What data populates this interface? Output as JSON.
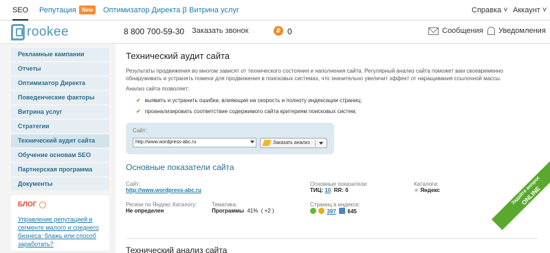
{
  "topnav": {
    "tabs": [
      {
        "label": "SEO"
      },
      {
        "label": "Репутация",
        "badge": "New"
      },
      {
        "label": "Оптимизатор Директа β"
      },
      {
        "label": "Витрина услуг"
      }
    ],
    "help": "Справка",
    "account": "Аккаунт"
  },
  "header": {
    "logo": "rookee",
    "phone": "8 800 700-59-30",
    "callback": "Заказать звонок",
    "coin": "₽",
    "balance": "0",
    "messages": "Сообщения",
    "notifications": "Уведомления"
  },
  "sidebar": {
    "items": [
      {
        "label": "Рекламные кампании"
      },
      {
        "label": "Отчеты"
      },
      {
        "label": "Оптимизатор Директа"
      },
      {
        "label": "Поведенческие факторы"
      },
      {
        "label": "Витрина услуг"
      },
      {
        "label": "Стратегии"
      },
      {
        "label": "Технический аудит сайта"
      },
      {
        "label": "Обучение основам SEO"
      },
      {
        "label": "Партнерская программа"
      },
      {
        "label": "Документы"
      }
    ],
    "blog_title": "БЛОГ",
    "blog_link": "Управление репутацией в сегменте малого и среднего бизнеса: блажь или способ заработать?"
  },
  "main": {
    "title": "Технический аудит сайта",
    "intro": "Результаты продвижения во многом зависят от технического состояния и наполнения сайта. Регулярный анализ сайта поможет вам своевременно обнаруживать и устранять помехи для продвижения в поисковых системах, что значительно увеличит эффект от наращивания ссылочной массы.",
    "allows": "Анализ сайта позволяет:",
    "bullets": [
      "выявить и устранить ошибки, влияющие на скорость и полноту индексации страниц;",
      "проанализировать соответствие содержимого сайта критериям поисковых систем;"
    ],
    "site_label": "Сайт:",
    "site_value": "http://www.wordpress-abc.ru",
    "order_button": "Заказать анализ",
    "section_title": "Основные показатели сайта",
    "site_field_label": "Сайт:",
    "site_link": "http://www.wordpress-abc.ru",
    "indicators_label": "Основные показатели:",
    "tic_label": "ТИЦ:",
    "tic_value": "10",
    "rr_label": "RR:",
    "rr_value": "0",
    "catalogs_label": "Каталоги:",
    "catalogs_value": "Яндекс",
    "region_label": "Регион по Яндекс Каталогу:",
    "region_value": "Не определен",
    "theme_label": "Тематика:",
    "theme_value": "Программы",
    "theme_percent": "41%",
    "theme_delta": "( +2 )",
    "pages_label": "Страниц в индексе:",
    "pages_yandex": "397",
    "pages_google": "645",
    "tech_title": "Технический анализ сайта"
  },
  "ribbon": {
    "line1": "Задайте вопрос",
    "line2": "ONLINE"
  },
  "colors": {
    "accent": "#2b6c8e",
    "link": "#1f7aa8",
    "badge": "#ff8a2b",
    "sidebar_bg": "#e6eef3",
    "ribbon": "#5aa82e"
  }
}
